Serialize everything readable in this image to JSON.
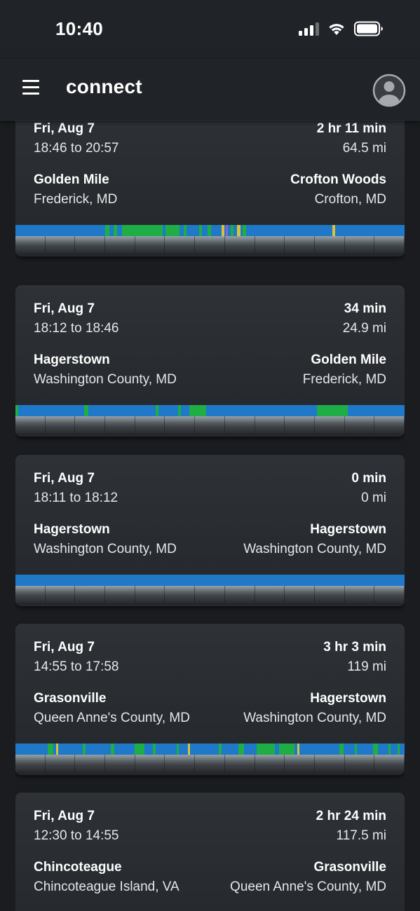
{
  "status_bar": {
    "time": "10:40"
  },
  "header": {
    "title": "connect"
  },
  "trips": [
    {
      "date": "Fri, Aug 7",
      "time_range": "18:46 to 20:57",
      "duration": "2 hr 11 min",
      "distance": "64.5 mi",
      "start_place": "Golden Mile",
      "start_region": "Frederick, MD",
      "end_place": "Crofton Woods",
      "end_region": "Crofton, MD"
    },
    {
      "date": "Fri, Aug 7",
      "time_range": "18:12 to 18:46",
      "duration": "34 min",
      "distance": "24.9 mi",
      "start_place": "Hagerstown",
      "start_region": "Washington County, MD",
      "end_place": "Golden Mile",
      "end_region": "Frederick, MD"
    },
    {
      "date": "Fri, Aug 7",
      "time_range": "18:11 to 18:12",
      "duration": "0 min",
      "distance": "0 mi",
      "start_place": "Hagerstown",
      "start_region": "Washington County, MD",
      "end_place": "Hagerstown",
      "end_region": "Washington County, MD"
    },
    {
      "date": "Fri, Aug 7",
      "time_range": "14:55 to 17:58",
      "duration": "3 hr 3 min",
      "distance": "119 mi",
      "start_place": "Grasonville",
      "start_region": "Queen Anne's County, MD",
      "end_place": "Hagerstown",
      "end_region": "Washington County, MD"
    },
    {
      "date": "Fri, Aug 7",
      "time_range": "12:30 to 14:55",
      "duration": "2 hr 24 min",
      "distance": "117.5 mi",
      "start_place": "Chincoteague",
      "start_region": "Chincoteague Island, VA",
      "end_place": "Grasonville",
      "end_region": "Queen Anne's County, MD"
    }
  ],
  "colors": {
    "background": "#1a1c1f",
    "header": "#202327",
    "card": "#2e3237",
    "timeline_blue": "#1f78c8",
    "timeline_green": "#1fae45",
    "timeline_yellow": "#d7c23a",
    "timeline_purple": "#8a63d2"
  },
  "icons": {
    "menu": "hamburger-icon",
    "account": "account-circle-icon",
    "signal": "cellular-signal-icon",
    "wifi": "wifi-icon",
    "battery": "battery-icon"
  }
}
